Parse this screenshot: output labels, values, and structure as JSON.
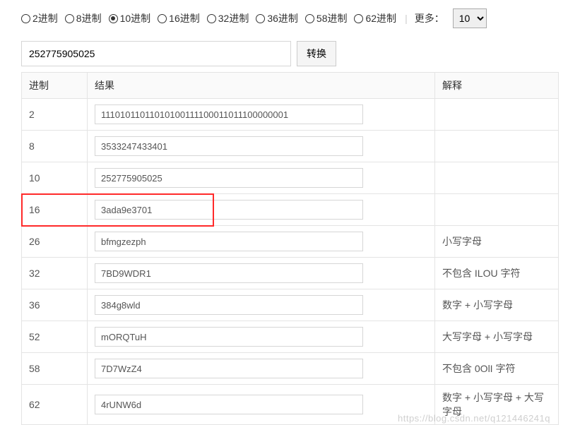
{
  "radios": [
    {
      "label": "2进制",
      "value": "2",
      "selected": false
    },
    {
      "label": "8进制",
      "value": "8",
      "selected": false
    },
    {
      "label": "10进制",
      "value": "10",
      "selected": true
    },
    {
      "label": "16进制",
      "value": "16",
      "selected": false
    },
    {
      "label": "32进制",
      "value": "32",
      "selected": false
    },
    {
      "label": "36进制",
      "value": "36",
      "selected": false
    },
    {
      "label": "58进制",
      "value": "58",
      "selected": false
    },
    {
      "label": "62进制",
      "value": "62",
      "selected": false
    }
  ],
  "more": {
    "separator": "|",
    "label": "更多：",
    "value": "10"
  },
  "input": {
    "value": "252775905025"
  },
  "convert_label": "转换",
  "table": {
    "headers": {
      "base": "进制",
      "result": "结果",
      "explain": "解释"
    },
    "rows": [
      {
        "base": "2",
        "result": "11101011011010100111100011011100000001",
        "explain": ""
      },
      {
        "base": "8",
        "result": "3533247433401",
        "explain": ""
      },
      {
        "base": "10",
        "result": "252775905025",
        "explain": ""
      },
      {
        "base": "16",
        "result": "3ada9e3701",
        "explain": "",
        "highlight": true
      },
      {
        "base": "26",
        "result": "bfmgzezph",
        "explain": "小写字母"
      },
      {
        "base": "32",
        "result": "7BD9WDR1",
        "explain": "不包含 ILOU 字符"
      },
      {
        "base": "36",
        "result": "384g8wld",
        "explain": "数字 + 小写字母"
      },
      {
        "base": "52",
        "result": "mORQTuH",
        "explain": "大写字母 + 小写字母"
      },
      {
        "base": "58",
        "result": "7D7WzZ4",
        "explain": "不包含 0OlI 字符"
      },
      {
        "base": "62",
        "result": "4rUNW6d",
        "explain": "数字 + 小写字母 + 大写字母"
      }
    ]
  },
  "watermark": "https://blog.csdn.net/q121446241q"
}
